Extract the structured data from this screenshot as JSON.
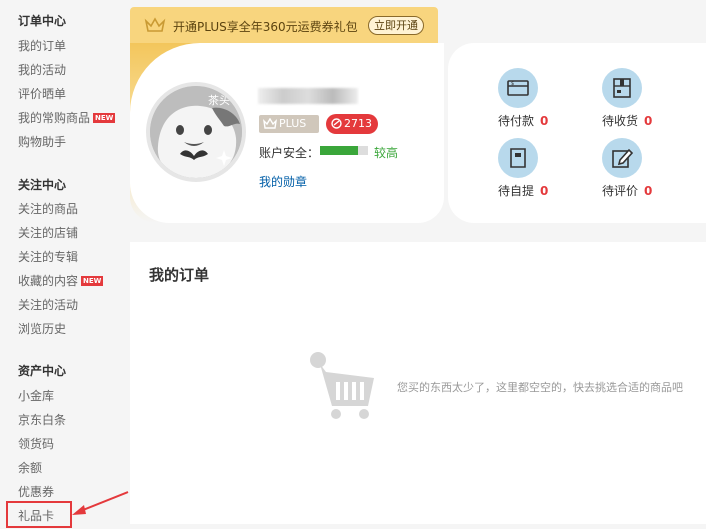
{
  "sidebar": {
    "sections": [
      {
        "title": "订单中心",
        "items": [
          {
            "label": "我的订单"
          },
          {
            "label": "我的活动"
          },
          {
            "label": "评价晒单"
          },
          {
            "label": "我的常购商品",
            "badge": "NEW"
          },
          {
            "label": "购物助手"
          }
        ]
      },
      {
        "title": "关注中心",
        "items": [
          {
            "label": "关注的商品"
          },
          {
            "label": "关注的店铺"
          },
          {
            "label": "关注的专辑"
          },
          {
            "label": "收藏的内容",
            "badge": "NEW"
          },
          {
            "label": "关注的活动"
          },
          {
            "label": "浏览历史"
          }
        ]
      },
      {
        "title": "资产中心",
        "items": [
          {
            "label": "小金库"
          },
          {
            "label": "京东白条"
          },
          {
            "label": "领货码"
          },
          {
            "label": "余额"
          },
          {
            "label": "优惠券"
          },
          {
            "label": "礼品卡",
            "highlighted": true
          }
        ]
      }
    ]
  },
  "plus_banner": {
    "text": "开通PLUS享全年360元运费券礼包",
    "button": "立即开通",
    "icon": "crown-icon"
  },
  "profile": {
    "avatar_text": "茶头",
    "plus_badge": "PLUS",
    "points": "2713",
    "security_label": "账户安全：",
    "security_level": "较高",
    "security_ratio": 0.8,
    "medal_link": "我的勋章"
  },
  "quick_orders": [
    {
      "label": "待付款",
      "count": "0",
      "icon": "wallet-icon"
    },
    {
      "label": "待收货",
      "count": "0",
      "icon": "package-icon"
    },
    {
      "label": "待自提",
      "count": "0",
      "icon": "pickup-bag-icon"
    },
    {
      "label": "待评价",
      "count": "0",
      "icon": "review-edit-icon"
    }
  ],
  "orders": {
    "title": "我的订单",
    "empty_text": "您买的东西太少了，这里都空空的，快去挑选合适的商品吧"
  },
  "colors": {
    "accent_red": "#e4393c",
    "plus_gold": "#f8d57e",
    "link_blue": "#005ea7",
    "security_green": "#3aa63a"
  }
}
